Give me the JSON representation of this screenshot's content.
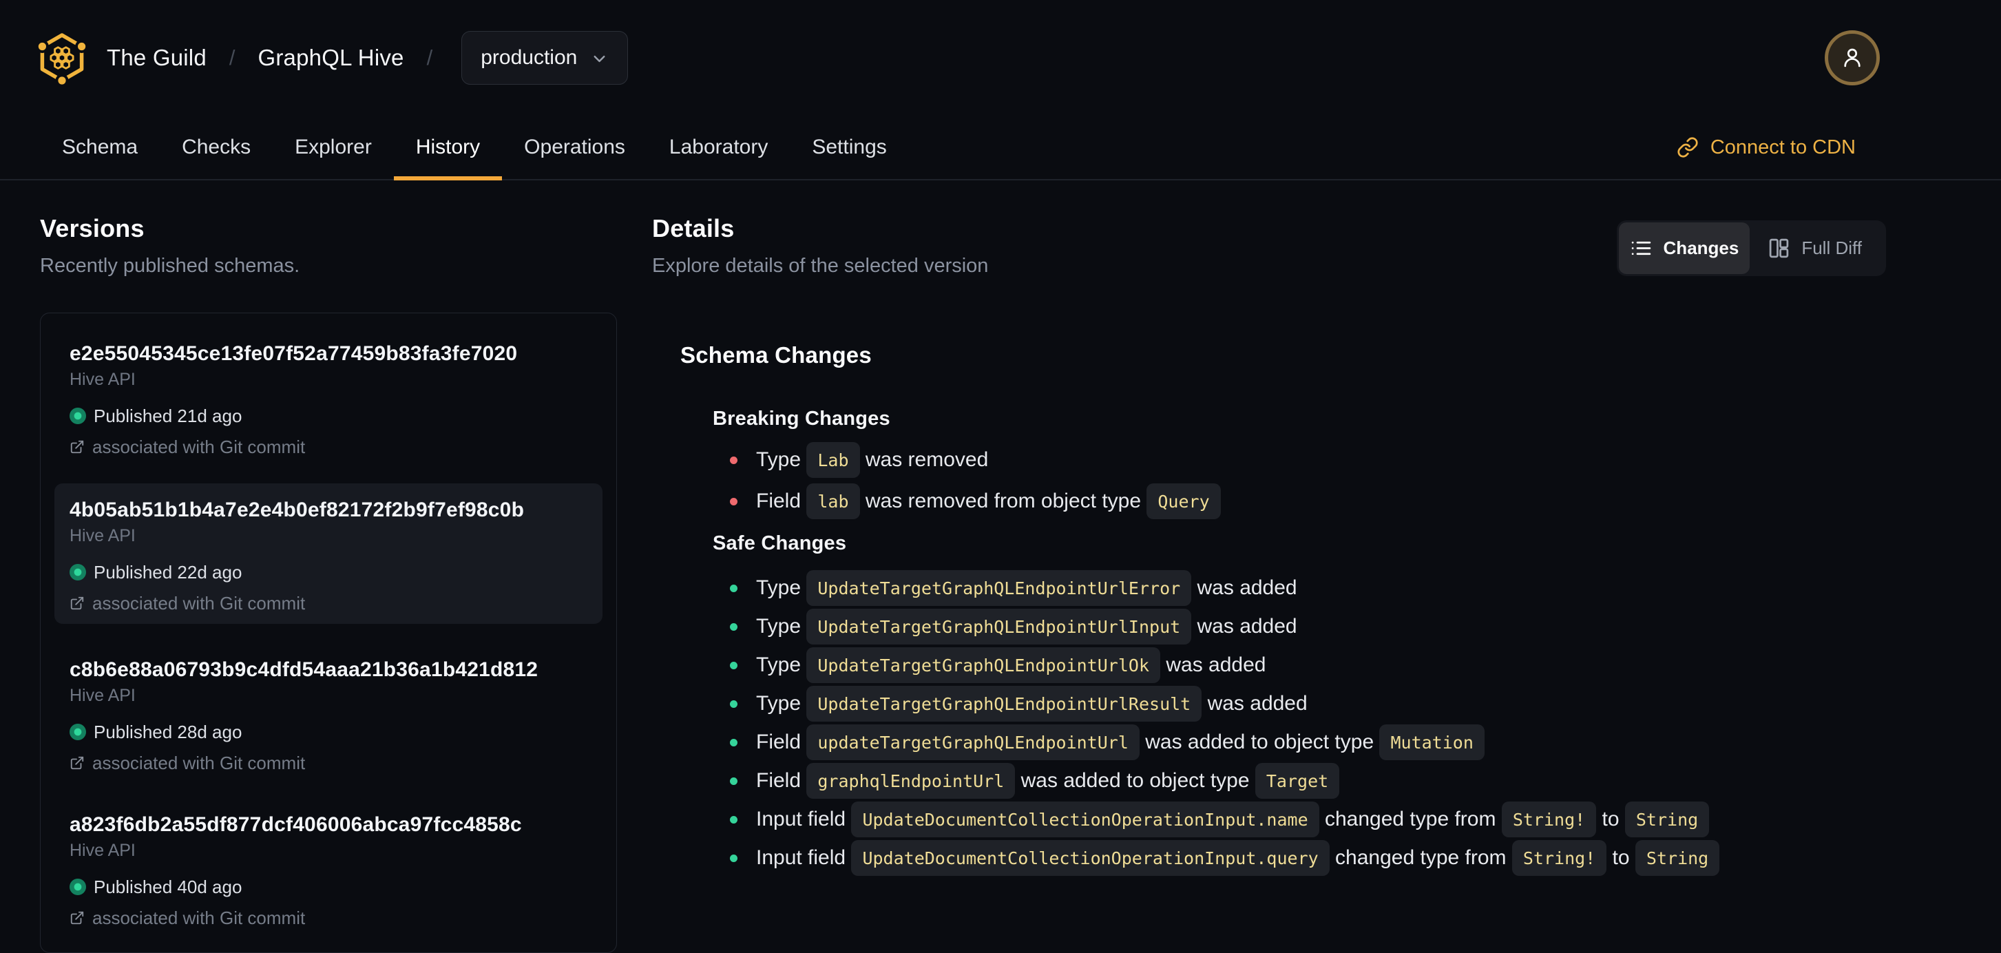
{
  "header": {
    "brand": "The Guild",
    "product": "GraphQL Hive",
    "separator": "/",
    "target_selector": {
      "value": "production"
    }
  },
  "nav": {
    "tabs": [
      {
        "label": "Schema",
        "active": false
      },
      {
        "label": "Checks",
        "active": false
      },
      {
        "label": "Explorer",
        "active": false
      },
      {
        "label": "History",
        "active": true
      },
      {
        "label": "Operations",
        "active": false
      },
      {
        "label": "Laboratory",
        "active": false
      },
      {
        "label": "Settings",
        "active": false
      }
    ],
    "cdn_link": "Connect to CDN"
  },
  "versions": {
    "title": "Versions",
    "subtitle": "Recently published schemas.",
    "items": [
      {
        "hash": "e2e55045345ce13fe07f52a77459b83fa3fe7020",
        "service": "Hive API",
        "published": "Published 21d ago",
        "git": "associated with Git commit",
        "selected": false
      },
      {
        "hash": "4b05ab51b1b4a7e2e4b0ef82172f2b9f7ef98c0b",
        "service": "Hive API",
        "published": "Published 22d ago",
        "git": "associated with Git commit",
        "selected": true
      },
      {
        "hash": "c8b6e88a06793b9c4dfd54aaa21b36a1b421d812",
        "service": "Hive API",
        "published": "Published 28d ago",
        "git": "associated with Git commit",
        "selected": false
      },
      {
        "hash": "a823f6db2a55df877dcf406006abca97fcc4858c",
        "service": "Hive API",
        "published": "Published 40d ago",
        "git": "associated with Git commit",
        "selected": false
      }
    ]
  },
  "details": {
    "title": "Details",
    "subtitle": "Explore details of the selected version",
    "view_toggle": {
      "changes_label": "Changes",
      "full_diff_label": "Full Diff",
      "selected": "Changes"
    },
    "schema_changes_title": "Schema Changes",
    "breaking": {
      "title": "Breaking Changes",
      "items": [
        [
          {
            "t": "text",
            "v": "Type "
          },
          {
            "t": "code",
            "v": "Lab"
          },
          {
            "t": "text",
            "v": " was removed"
          }
        ],
        [
          {
            "t": "text",
            "v": "Field "
          },
          {
            "t": "code",
            "v": "lab"
          },
          {
            "t": "text",
            "v": " was removed from object type "
          },
          {
            "t": "code",
            "v": "Query"
          }
        ]
      ]
    },
    "safe": {
      "title": "Safe Changes",
      "items": [
        [
          {
            "t": "text",
            "v": "Type "
          },
          {
            "t": "code",
            "v": "UpdateTargetGraphQLEndpointUrlError"
          },
          {
            "t": "text",
            "v": " was added"
          }
        ],
        [
          {
            "t": "text",
            "v": "Type "
          },
          {
            "t": "code",
            "v": "UpdateTargetGraphQLEndpointUrlInput"
          },
          {
            "t": "text",
            "v": " was added"
          }
        ],
        [
          {
            "t": "text",
            "v": "Type "
          },
          {
            "t": "code",
            "v": "UpdateTargetGraphQLEndpointUrlOk"
          },
          {
            "t": "text",
            "v": " was added"
          }
        ],
        [
          {
            "t": "text",
            "v": "Type "
          },
          {
            "t": "code",
            "v": "UpdateTargetGraphQLEndpointUrlResult"
          },
          {
            "t": "text",
            "v": " was added"
          }
        ],
        [
          {
            "t": "text",
            "v": "Field "
          },
          {
            "t": "code",
            "v": "updateTargetGraphQLEndpointUrl"
          },
          {
            "t": "text",
            "v": " was added to object type "
          },
          {
            "t": "code",
            "v": "Mutation"
          }
        ],
        [
          {
            "t": "text",
            "v": "Field "
          },
          {
            "t": "code",
            "v": "graphqlEndpointUrl"
          },
          {
            "t": "text",
            "v": " was added to object type "
          },
          {
            "t": "code",
            "v": "Target"
          }
        ],
        [
          {
            "t": "text",
            "v": "Input field "
          },
          {
            "t": "code",
            "v": "UpdateDocumentCollectionOperationInput.name"
          },
          {
            "t": "text",
            "v": " changed type from "
          },
          {
            "t": "code",
            "v": "String!"
          },
          {
            "t": "text",
            "v": " to "
          },
          {
            "t": "code",
            "v": "String"
          }
        ],
        [
          {
            "t": "text",
            "v": "Input field "
          },
          {
            "t": "code",
            "v": "UpdateDocumentCollectionOperationInput.query"
          },
          {
            "t": "text",
            "v": " changed type from "
          },
          {
            "t": "code",
            "v": "String!"
          },
          {
            "t": "text",
            "v": " to "
          },
          {
            "t": "code",
            "v": "String"
          }
        ]
      ]
    }
  },
  "colors": {
    "background": "#0a0c11",
    "accent_gold": "#f3a83a",
    "link_gold": "#eeb245",
    "logo_gold": "#f1b43c",
    "chip_text": "#f0dd96",
    "chip_bg": "#1f2228",
    "published_green": "#2ed79b",
    "breaking_red": "#ef6a6e",
    "safe_green": "#35d49a"
  }
}
